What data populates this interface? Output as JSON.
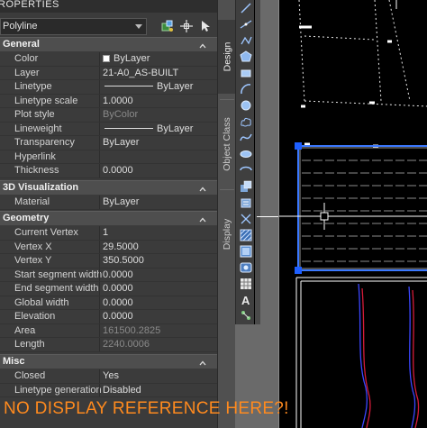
{
  "palette": {
    "title": "ROPERTIES",
    "selector_value": "Polyline",
    "sections": {
      "general": "General",
      "visualization": "3D Visualization",
      "geometry": "Geometry",
      "misc": "Misc"
    },
    "general_rows": [
      {
        "label": "Color",
        "value": "ByLayer"
      },
      {
        "label": "Layer",
        "value": "21-A0_AS-BUILT"
      },
      {
        "label": "Linetype",
        "value": "ByLayer"
      },
      {
        "label": "Linetype scale",
        "value": "1.0000"
      },
      {
        "label": "Plot style",
        "value": "ByColor"
      },
      {
        "label": "Lineweight",
        "value": "ByLayer"
      },
      {
        "label": "Transparency",
        "value": "ByLayer"
      },
      {
        "label": "Hyperlink",
        "value": ""
      },
      {
        "label": "Thickness",
        "value": "0.0000"
      }
    ],
    "visualization_rows": [
      {
        "label": "Material",
        "value": "ByLayer"
      }
    ],
    "geometry_rows": [
      {
        "label": "Current Vertex",
        "value": "1"
      },
      {
        "label": "Vertex X",
        "value": "29.5000"
      },
      {
        "label": "Vertex Y",
        "value": "350.5000"
      },
      {
        "label": "Start segment width",
        "value": "0.0000"
      },
      {
        "label": "End segment width",
        "value": "0.0000"
      },
      {
        "label": "Global width",
        "value": "0.0000"
      },
      {
        "label": "Elevation",
        "value": "0.0000"
      },
      {
        "label": "Area",
        "value": "161500.2825"
      },
      {
        "label": "Length",
        "value": "2240.0006"
      }
    ],
    "misc_rows": [
      {
        "label": "Closed",
        "value": "Yes"
      },
      {
        "label": "Linetype generation",
        "value": "Disabled"
      }
    ]
  },
  "side_tabs": {
    "design": "Design",
    "object_class": "Object Class",
    "display": "Display"
  },
  "annotation": "NO DISPLAY REFERENCE HERE?!",
  "colors": {
    "annotation": "#ff8a1e",
    "selection": "#3a78ff",
    "grip": "#1e5fff"
  }
}
